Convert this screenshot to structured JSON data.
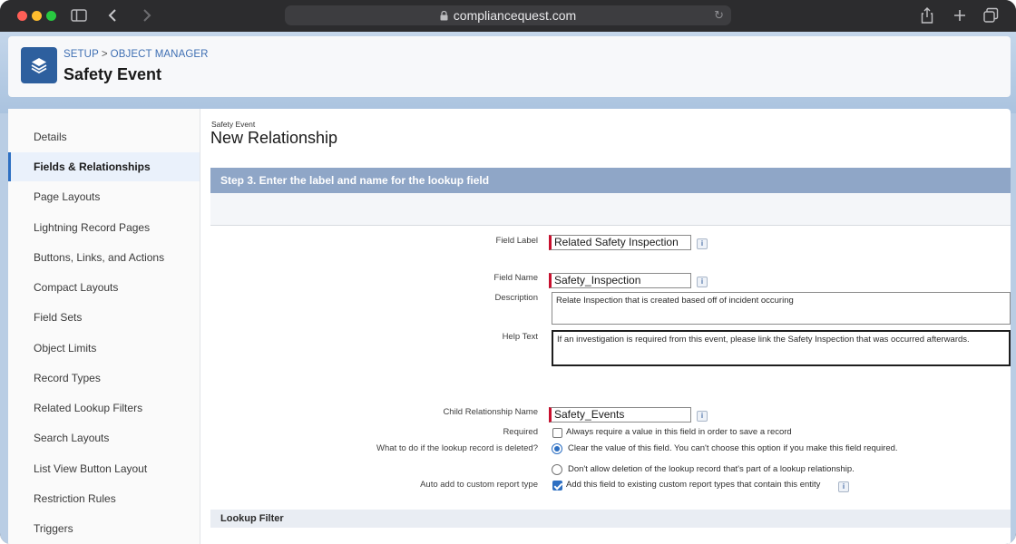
{
  "browser": {
    "url": "compliancequest.com"
  },
  "header": {
    "breadcrumb": [
      "SETUP",
      "OBJECT MANAGER"
    ],
    "breadcrumb_sep": ">",
    "object_title": "Safety Event"
  },
  "sidebar": {
    "items": [
      {
        "label": "Details"
      },
      {
        "label": "Fields & Relationships",
        "active": true
      },
      {
        "label": "Page Layouts"
      },
      {
        "label": "Lightning Record Pages"
      },
      {
        "label": "Buttons, Links, and Actions"
      },
      {
        "label": "Compact Layouts"
      },
      {
        "label": "Field Sets"
      },
      {
        "label": "Object Limits"
      },
      {
        "label": "Record Types"
      },
      {
        "label": "Related Lookup Filters"
      },
      {
        "label": "Search Layouts"
      },
      {
        "label": "List View Button Layout"
      },
      {
        "label": "Restriction Rules"
      },
      {
        "label": "Triggers"
      }
    ]
  },
  "main": {
    "subtitle": "Safety Event",
    "title": "New Relationship",
    "step_title": "Step 3. Enter the label and name for the lookup field",
    "form": {
      "field_label": {
        "label": "Field Label",
        "value": "Related Safety Inspection"
      },
      "field_name": {
        "label": "Field Name",
        "value": "Safety_Inspection"
      },
      "description": {
        "label": "Description",
        "value": "Relate Inspection that is created based off of incident occuring"
      },
      "help_text": {
        "label": "Help Text",
        "value": "If an investigation is required from this event, please link the Safety Inspection that was occurred afterwards."
      },
      "child_relationship": {
        "label": "Child Relationship Name",
        "value": "Safety_Events"
      },
      "required": {
        "label": "Required",
        "option": "Always require a value in this field in order to save a record",
        "checked": false
      },
      "on_delete": {
        "label": "What to do if the lookup record is deleted?",
        "options": [
          {
            "label": "Clear the value of this field. You can't choose this option if you make this field required.",
            "selected": true
          },
          {
            "label": "Don't allow deletion of the lookup record that's part of a lookup relationship.",
            "selected": false
          }
        ]
      },
      "auto_add": {
        "label": "Auto add to custom report type",
        "option": "Add this field to existing custom report types that contain this entity",
        "checked": true
      }
    },
    "lookup_filter_title": "Lookup Filter"
  },
  "icons": {
    "info": "i"
  },
  "colors": {
    "brand_blue": "#2d5f9e",
    "step_bar": "#8fa6c7",
    "required_marker": "#c8102e",
    "link": "#3f6fb3"
  }
}
